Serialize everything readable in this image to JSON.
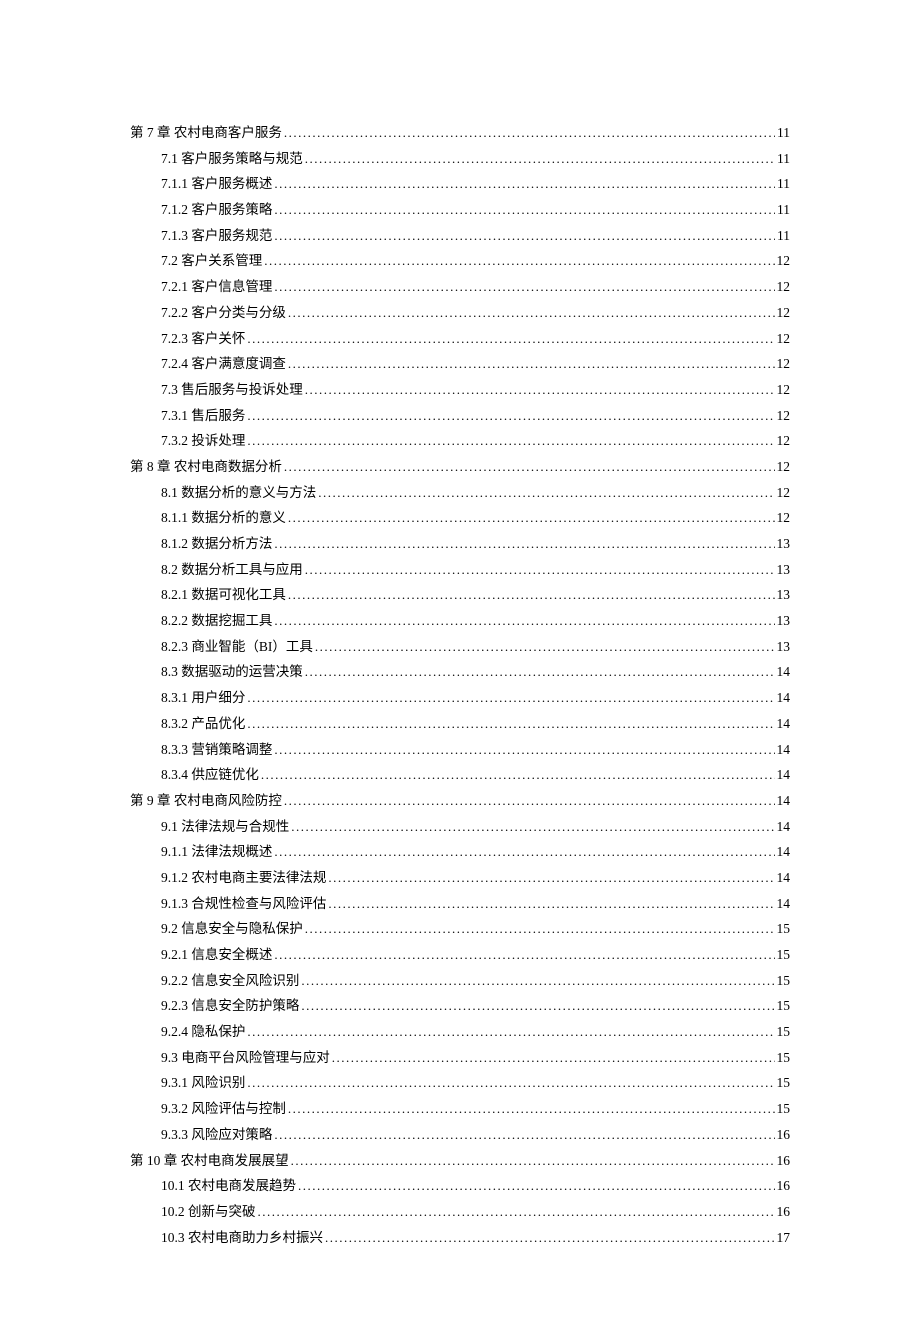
{
  "toc": [
    {
      "level": 0,
      "title": "第 7 章 农村电商客户服务",
      "page": "11"
    },
    {
      "level": 1,
      "title": "7.1 客户服务策略与规范",
      "page": "11"
    },
    {
      "level": 1,
      "title": "7.1.1 客户服务概述",
      "page": "11"
    },
    {
      "level": 1,
      "title": "7.1.2 客户服务策略",
      "page": "11"
    },
    {
      "level": 1,
      "title": "7.1.3 客户服务规范",
      "page": "11"
    },
    {
      "level": 1,
      "title": "7.2 客户关系管理",
      "page": "12"
    },
    {
      "level": 1,
      "title": "7.2.1 客户信息管理",
      "page": "12"
    },
    {
      "level": 1,
      "title": "7.2.2 客户分类与分级",
      "page": "12"
    },
    {
      "level": 1,
      "title": "7.2.3 客户关怀 ",
      "page": "12"
    },
    {
      "level": 1,
      "title": "7.2.4 客户满意度调查",
      "page": "12"
    },
    {
      "level": 1,
      "title": "7.3 售后服务与投诉处理",
      "page": "12"
    },
    {
      "level": 1,
      "title": "7.3.1 售后服务 ",
      "page": "12"
    },
    {
      "level": 1,
      "title": "7.3.2 投诉处理 ",
      "page": "12"
    },
    {
      "level": 0,
      "title": "第 8 章 农村电商数据分析",
      "page": "12"
    },
    {
      "level": 1,
      "title": "8.1 数据分析的意义与方法",
      "page": "12"
    },
    {
      "level": 1,
      "title": "8.1.1 数据分析的意义",
      "page": "12"
    },
    {
      "level": 1,
      "title": "8.1.2 数据分析方法",
      "page": "13"
    },
    {
      "level": 1,
      "title": "8.2 数据分析工具与应用",
      "page": "13"
    },
    {
      "level": 1,
      "title": "8.2.1 数据可视化工具",
      "page": "13"
    },
    {
      "level": 1,
      "title": "8.2.2 数据挖掘工具",
      "page": "13"
    },
    {
      "level": 1,
      "title": "8.2.3 商业智能（BI）工具",
      "page": "13"
    },
    {
      "level": 1,
      "title": "8.3 数据驱动的运营决策",
      "page": "14"
    },
    {
      "level": 1,
      "title": "8.3.1 用户细分 ",
      "page": "14"
    },
    {
      "level": 1,
      "title": "8.3.2 产品优化 ",
      "page": "14"
    },
    {
      "level": 1,
      "title": "8.3.3 营销策略调整",
      "page": "14"
    },
    {
      "level": 1,
      "title": "8.3.4 供应链优化",
      "page": "14"
    },
    {
      "level": 0,
      "title": "第 9 章 农村电商风险防控",
      "page": "14"
    },
    {
      "level": 1,
      "title": "9.1 法律法规与合规性",
      "page": "14"
    },
    {
      "level": 1,
      "title": "9.1.1 法律法规概述",
      "page": "14"
    },
    {
      "level": 1,
      "title": "9.1.2 农村电商主要法律法规",
      "page": "14"
    },
    {
      "level": 1,
      "title": "9.1.3 合规性检查与风险评估",
      "page": "14"
    },
    {
      "level": 1,
      "title": "9.2 信息安全与隐私保护",
      "page": "15"
    },
    {
      "level": 1,
      "title": "9.2.1 信息安全概述",
      "page": "15"
    },
    {
      "level": 1,
      "title": "9.2.2 信息安全风险识别",
      "page": "15"
    },
    {
      "level": 1,
      "title": "9.2.3 信息安全防护策略",
      "page": "15"
    },
    {
      "level": 1,
      "title": "9.2.4 隐私保护 ",
      "page": "15"
    },
    {
      "level": 1,
      "title": "9.3 电商平台风险管理与应对",
      "page": "15"
    },
    {
      "level": 1,
      "title": "9.3.1 风险识别 ",
      "page": "15"
    },
    {
      "level": 1,
      "title": "9.3.2 风险评估与控制",
      "page": "15"
    },
    {
      "level": 1,
      "title": "9.3.3 风险应对策略",
      "page": "16"
    },
    {
      "level": 0,
      "title": "第 10 章 农村电商发展展望",
      "page": "16"
    },
    {
      "level": 1,
      "title": "10.1 农村电商发展趋势",
      "page": "16"
    },
    {
      "level": 1,
      "title": "10.2 创新与突破",
      "page": "16"
    },
    {
      "level": 1,
      "title": "10.3 农村电商助力乡村振兴",
      "page": "17"
    }
  ]
}
